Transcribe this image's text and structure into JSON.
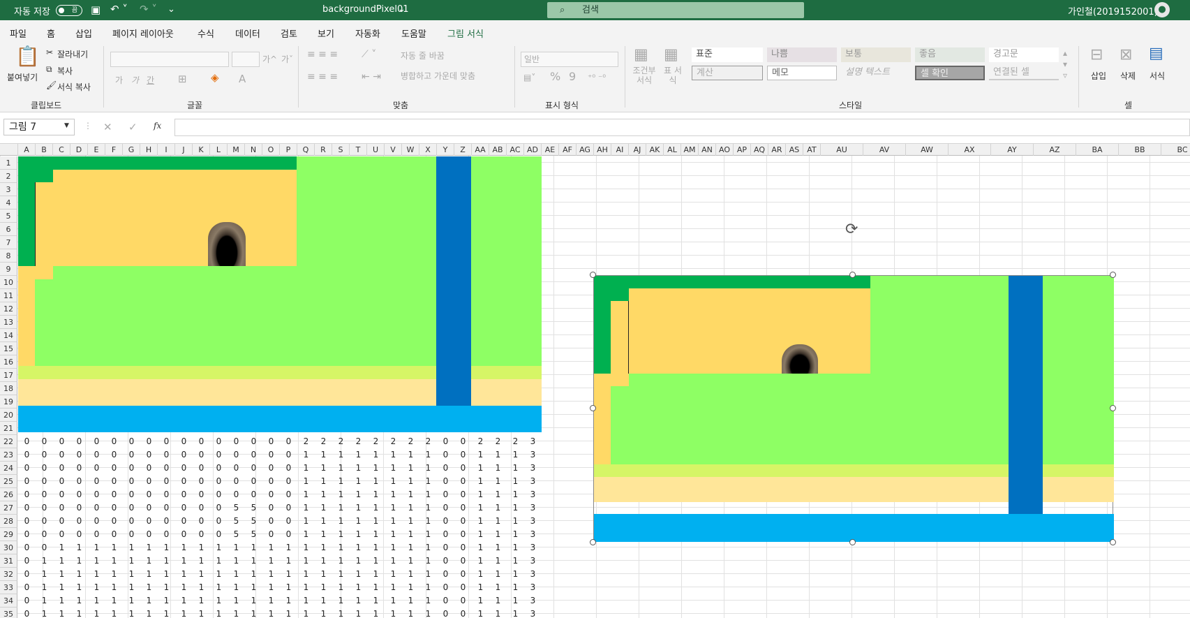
{
  "titlebar": {
    "autosave": "자동 저장",
    "toggle": "끔",
    "filename": "backgroundPixel01",
    "search": "검색",
    "user": "가인철(2019152001)"
  },
  "tabs": [
    "파일",
    "홈",
    "삽입",
    "페이지 레이아웃",
    "수식",
    "데이터",
    "검토",
    "보기",
    "자동화",
    "도움말",
    "그림 서식"
  ],
  "ribbon": {
    "clipboard": {
      "paste": "붙여넣기",
      "cut": "잘라내기",
      "copy": "복사",
      "format_painter": "서식 복사",
      "label": "클립보드"
    },
    "font": {
      "label": "글꼴",
      "grow": "가^",
      "shrink": "가ˇ",
      "bold": "가",
      "italic": "가",
      "underline": "간"
    },
    "align": {
      "wrap": "자동 줄 바꿈",
      "merge": "병합하고 가운데 맞춤",
      "label": "맞춤"
    },
    "number": {
      "format": "일반",
      "percent": "%",
      "comma": "9",
      "label": "표시 형식"
    },
    "styles": {
      "conditional": "조건부 서식",
      "table": "표 서식",
      "normal": "표준",
      "bad": "나쁨",
      "neutral": "보통",
      "good": "좋음",
      "warning": "경고문",
      "calculation": "계산",
      "memo": "메모",
      "explanatory": "설명 텍스트",
      "check": "셀 확인",
      "linked": "연결된 셀",
      "label": "스타일"
    },
    "cells": {
      "insert": "삽입",
      "delete": "삭제",
      "format": "서식",
      "label": "셀"
    }
  },
  "formula": {
    "namebox": "그림 7",
    "fx": "fx",
    "value": ""
  },
  "columns": [
    "A",
    "B",
    "C",
    "D",
    "E",
    "F",
    "G",
    "H",
    "I",
    "J",
    "K",
    "L",
    "M",
    "N",
    "O",
    "P",
    "Q",
    "R",
    "S",
    "T",
    "U",
    "V",
    "W",
    "X",
    "Y",
    "Z",
    "AA",
    "AB",
    "AC",
    "AD",
    "AE",
    "AF",
    "AG",
    "AH",
    "AI",
    "AJ",
    "AK",
    "AL",
    "AM",
    "AN",
    "AO",
    "AP",
    "AQ",
    "AR",
    "AS",
    "AT",
    "AU",
    "AV",
    "AW",
    "AX",
    "AY",
    "AZ",
    "BA",
    "BB",
    "BC"
  ],
  "rows": [
    "1",
    "2",
    "3",
    "4",
    "5",
    "6",
    "7",
    "8",
    "9",
    "10",
    "11",
    "12",
    "13",
    "14",
    "15",
    "16",
    "17",
    "18",
    "19",
    "20",
    "21",
    "22",
    "23",
    "24",
    "25",
    "26",
    "27",
    "28",
    "29",
    "30",
    "31",
    "32",
    "33",
    "34",
    "35"
  ],
  "grid": [
    [
      0,
      0,
      0,
      0,
      0,
      0,
      0,
      0,
      0,
      0,
      0,
      0,
      0,
      0,
      0,
      0,
      2,
      2,
      2,
      2,
      2,
      2,
      2,
      2,
      0,
      0,
      2,
      2,
      2,
      3
    ],
    [
      0,
      0,
      0,
      0,
      0,
      0,
      0,
      0,
      0,
      0,
      0,
      0,
      0,
      0,
      0,
      0,
      1,
      1,
      1,
      1,
      1,
      1,
      1,
      1,
      0,
      0,
      1,
      1,
      1,
      3
    ],
    [
      0,
      0,
      0,
      0,
      0,
      0,
      0,
      0,
      0,
      0,
      0,
      0,
      0,
      0,
      0,
      0,
      1,
      1,
      1,
      1,
      1,
      1,
      1,
      1,
      0,
      0,
      1,
      1,
      1,
      3
    ],
    [
      0,
      0,
      0,
      0,
      0,
      0,
      0,
      0,
      0,
      0,
      0,
      0,
      0,
      0,
      0,
      0,
      1,
      1,
      1,
      1,
      1,
      1,
      1,
      1,
      0,
      0,
      1,
      1,
      1,
      3
    ],
    [
      0,
      0,
      0,
      0,
      0,
      0,
      0,
      0,
      0,
      0,
      0,
      0,
      0,
      0,
      0,
      0,
      1,
      1,
      1,
      1,
      1,
      1,
      1,
      1,
      0,
      0,
      1,
      1,
      1,
      3
    ],
    [
      0,
      0,
      0,
      0,
      0,
      0,
      0,
      0,
      0,
      0,
      0,
      0,
      5,
      5,
      0,
      0,
      1,
      1,
      1,
      1,
      1,
      1,
      1,
      1,
      0,
      0,
      1,
      1,
      1,
      3
    ],
    [
      0,
      0,
      0,
      0,
      0,
      0,
      0,
      0,
      0,
      0,
      0,
      0,
      5,
      5,
      0,
      0,
      1,
      1,
      1,
      1,
      1,
      1,
      1,
      1,
      0,
      0,
      1,
      1,
      1,
      3
    ],
    [
      0,
      0,
      0,
      0,
      0,
      0,
      0,
      0,
      0,
      0,
      0,
      0,
      5,
      5,
      0,
      0,
      1,
      1,
      1,
      1,
      1,
      1,
      1,
      1,
      0,
      0,
      1,
      1,
      1,
      3
    ],
    [
      0,
      0,
      1,
      1,
      1,
      1,
      1,
      1,
      1,
      1,
      1,
      1,
      1,
      1,
      1,
      1,
      1,
      1,
      1,
      1,
      1,
      1,
      1,
      1,
      0,
      0,
      1,
      1,
      1,
      3
    ],
    [
      0,
      1,
      1,
      1,
      1,
      1,
      1,
      1,
      1,
      1,
      1,
      1,
      1,
      1,
      1,
      1,
      1,
      1,
      1,
      1,
      1,
      1,
      1,
      1,
      0,
      0,
      1,
      1,
      1,
      3
    ],
    [
      0,
      1,
      1,
      1,
      1,
      1,
      1,
      1,
      1,
      1,
      1,
      1,
      1,
      1,
      1,
      1,
      1,
      1,
      1,
      1,
      1,
      1,
      1,
      1,
      0,
      0,
      1,
      1,
      1,
      3
    ],
    [
      0,
      1,
      1,
      1,
      1,
      1,
      1,
      1,
      1,
      1,
      1,
      1,
      1,
      1,
      1,
      1,
      1,
      1,
      1,
      1,
      1,
      1,
      1,
      1,
      0,
      0,
      1,
      1,
      1,
      3
    ],
    [
      0,
      1,
      1,
      1,
      1,
      1,
      1,
      1,
      1,
      1,
      1,
      1,
      1,
      1,
      1,
      1,
      1,
      1,
      1,
      1,
      1,
      1,
      1,
      1,
      0,
      0,
      1,
      1,
      1,
      3
    ],
    [
      0,
      1,
      1,
      1,
      1,
      1,
      1,
      1,
      1,
      1,
      1,
      1,
      1,
      1,
      1,
      1,
      1,
      1,
      1,
      1,
      1,
      1,
      1,
      1,
      0,
      0,
      1,
      1,
      1,
      3
    ]
  ],
  "colors": {
    "dark_green": "#00b050",
    "light_green": "#8eff64",
    "yellow": "#ffd966",
    "lime": "#d6f566",
    "sand": "#ffe699",
    "blue": "#0070c0",
    "sky": "#00b0f0",
    "excel_green": "#1e6c41"
  }
}
